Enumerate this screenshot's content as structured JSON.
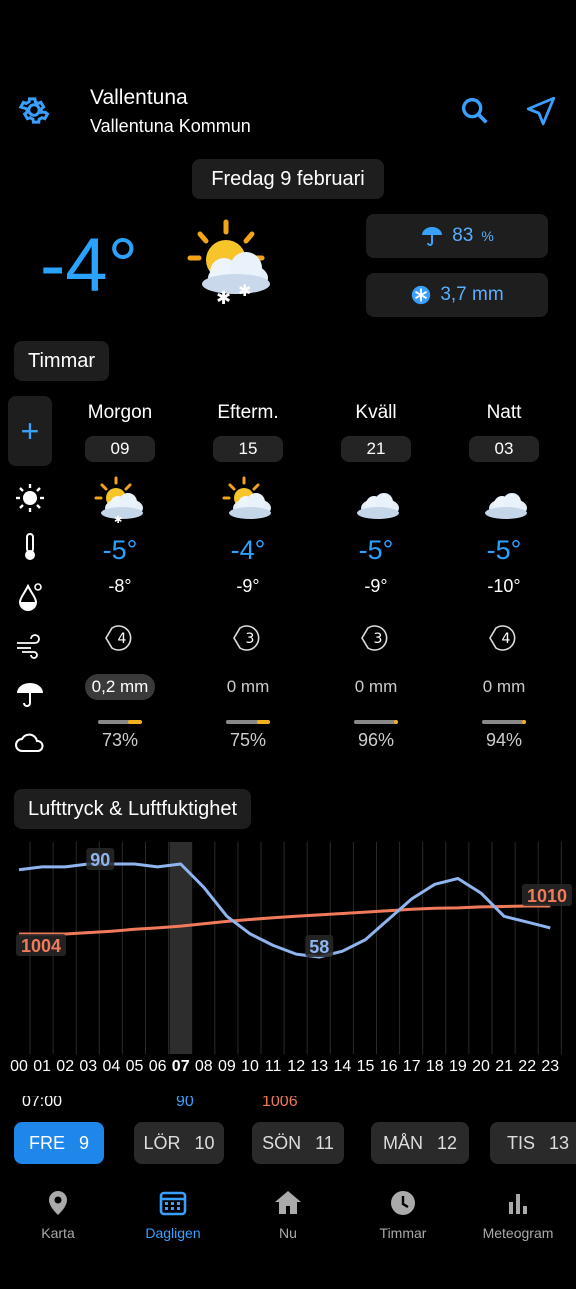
{
  "header": {
    "location": "Vallentuna",
    "municipality": "Vallentuna Kommun",
    "date": "Fredag 9 februari"
  },
  "current": {
    "temp": "-4°",
    "precip_prob_value": "83",
    "precip_prob_unit": "%",
    "precip_amount": "3,7 mm",
    "weather_icon": "sun-cloud-snow-icon"
  },
  "sections": {
    "hours_label": "Timmar",
    "pressure_label": "Lufttryck & Luftfuktighet"
  },
  "periods": [
    {
      "label": "Morgon",
      "hour": "09",
      "icon": "sun-cloud-snow-icon",
      "temp": "-5°",
      "feels": "-8°",
      "wind": "4",
      "precip": "0,2 mm",
      "precip_active": true,
      "cloud": "73%",
      "cloud_fraction": 0.73
    },
    {
      "label": "Efterm.",
      "hour": "15",
      "icon": "sun-cloud-icon",
      "temp": "-4°",
      "feels": "-9°",
      "wind": "3",
      "precip": "0 mm",
      "precip_active": false,
      "cloud": "75%",
      "cloud_fraction": 0.75
    },
    {
      "label": "Kväll",
      "hour": "21",
      "icon": "cloud-icon",
      "temp": "-5°",
      "feels": "-9°",
      "wind": "3",
      "precip": "0 mm",
      "precip_active": false,
      "cloud": "96%",
      "cloud_fraction": 0.96
    },
    {
      "label": "Natt",
      "hour": "03",
      "icon": "cloud-icon",
      "temp": "-5°",
      "feels": "-10°",
      "wind": "4",
      "precip": "0 mm",
      "precip_active": false,
      "cloud": "94%",
      "cloud_fraction": 0.94
    }
  ],
  "chart_data": {
    "type": "line",
    "x": [
      "00",
      "01",
      "02",
      "03",
      "04",
      "05",
      "06",
      "07",
      "08",
      "09",
      "10",
      "11",
      "12",
      "13",
      "14",
      "15",
      "16",
      "17",
      "18",
      "19",
      "20",
      "21",
      "22",
      "23"
    ],
    "highlight_x": "07",
    "series": [
      {
        "name": "",
        "color": "#8fb4ee",
        "values": [
          88,
          89,
          89,
          90,
          90,
          90,
          89,
          90,
          82,
          72,
          66,
          62,
          59,
          58,
          60,
          64,
          71,
          78,
          83,
          85,
          80,
          72,
          70,
          68
        ]
      },
      {
        "name": "",
        "color": "#f07a5a",
        "values": [
          1004,
          1004,
          1004,
          1004.3,
          1004.6,
          1005,
          1005.3,
          1005.7,
          1006.2,
          1006.7,
          1007.1,
          1007.5,
          1007.8,
          1008.1,
          1008.4,
          1008.7,
          1009,
          1009.3,
          1009.5,
          1009.6,
          1009.8,
          1009.9,
          1010,
          1010
        ]
      }
    ],
    "labels": {
      "max_humidity": "90",
      "min_humidity": "58",
      "start_pressure": "1004",
      "end_pressure": "1010"
    }
  },
  "partial_row": {
    "time": "07:00",
    "hum": "90",
    "press": "1006"
  },
  "days": [
    {
      "name": "FRE",
      "num": "9"
    },
    {
      "name": "LÖR",
      "num": "10"
    },
    {
      "name": "SÖN",
      "num": "11"
    },
    {
      "name": "MÅN",
      "num": "12"
    },
    {
      "name": "TIS",
      "num": "13"
    }
  ],
  "bottom_nav": [
    {
      "label": "Karta",
      "icon": "map-pin-icon"
    },
    {
      "label": "Dagligen",
      "icon": "calendar-icon"
    },
    {
      "label": "Nu",
      "icon": "home-icon"
    },
    {
      "label": "Timmar",
      "icon": "clock-icon"
    },
    {
      "label": "Meteogram",
      "icon": "bar-chart-icon"
    }
  ],
  "colors": {
    "accent": "#2aa3ff",
    "selected_day": "#1f86ea",
    "humidity": "#8fb4ee",
    "pressure": "#f07a5a"
  }
}
